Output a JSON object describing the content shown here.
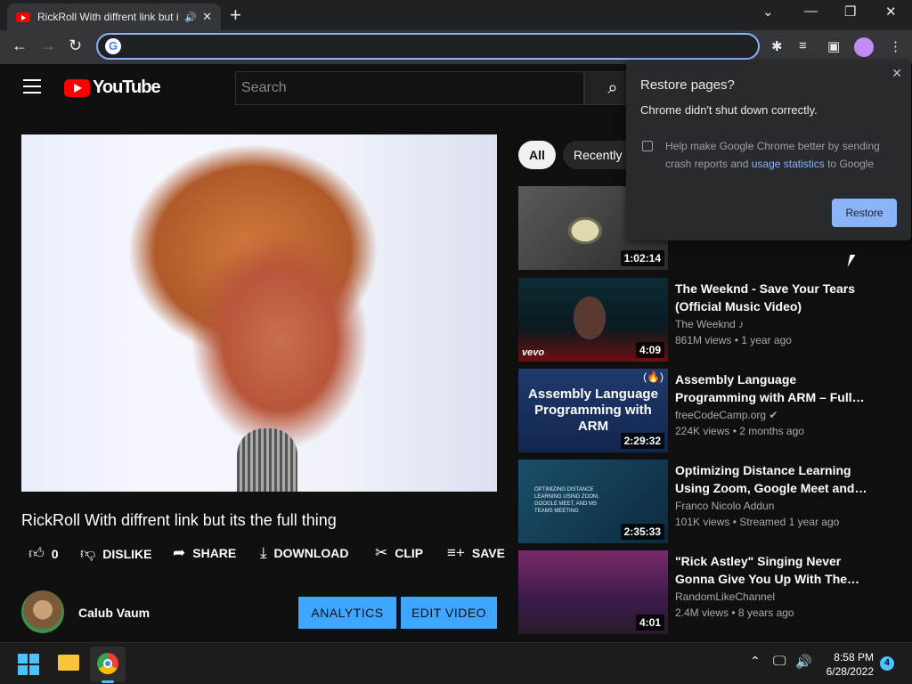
{
  "browser": {
    "tab_title": "RickRoll With diffrent link but its the full thing",
    "tab_audio_icon": "speaker-icon",
    "omnibox_value": "",
    "toolbar_icons": [
      "extensions-icon",
      "media-queue-icon",
      "side-panel-icon",
      "profile-avatar",
      "more-menu-icon"
    ]
  },
  "youtube": {
    "logo_text": "YouTube",
    "search_placeholder": "Search"
  },
  "video": {
    "title": "RickRoll With diffrent link but its the full thing",
    "like_count": "0",
    "dislike_label": "DISLIKE",
    "share_label": "SHARE",
    "download_label": "DOWNLOAD",
    "clip_label": "CLIP",
    "save_label": "SAVE",
    "channel_name": "Calub Vaum",
    "analytics_label": "ANALYTICS",
    "edit_label": "EDIT VIDEO"
  },
  "chips": [
    "All",
    "Recently"
  ],
  "recommendations": [
    {
      "title": "",
      "channel": "",
      "meta": "",
      "duration": "1:02:14"
    },
    {
      "title": "The Weeknd - Save Your Tears (Official Music Video)",
      "channel": "The Weeknd",
      "meta": "861M views • 1 year ago",
      "duration": "4:09",
      "badge": "vevo"
    },
    {
      "title": "Assembly Language Programming with ARM – Full…",
      "channel": "freeCodeCamp.org",
      "meta": "224K views • 2 months ago",
      "duration": "2:29:32",
      "thumb_text": "Assembly Language Programming with ARM"
    },
    {
      "title": "Optimizing Distance Learning Using Zoom, Google Meet and…",
      "channel": "Franco Nicolo Addun",
      "meta": "101K views • Streamed 1 year ago",
      "duration": "2:35:33",
      "thumb_text": "OPTIMIZING DISTANCE LEARNING USING ZOOM, GOOGLE MEET, AND MS TEAMS MEETING"
    },
    {
      "title": "\"Rick Astley\" Singing Never Gonna Give You Up With The…",
      "channel": "RandomLikeChannel",
      "meta": "2.4M views • 8 years ago",
      "duration": "4:01"
    }
  ],
  "popup": {
    "title": "Restore pages?",
    "body": "Chrome didn't shut down correctly.",
    "checkbox_text": "Help make Google Chrome better by sending crash reports and ",
    "checkbox_link": "usage statistics",
    "checkbox_suffix": " to Google",
    "restore_label": "Restore"
  },
  "taskbar": {
    "time": "8:58 PM",
    "date": "6/28/2022",
    "notification_count": "4"
  }
}
